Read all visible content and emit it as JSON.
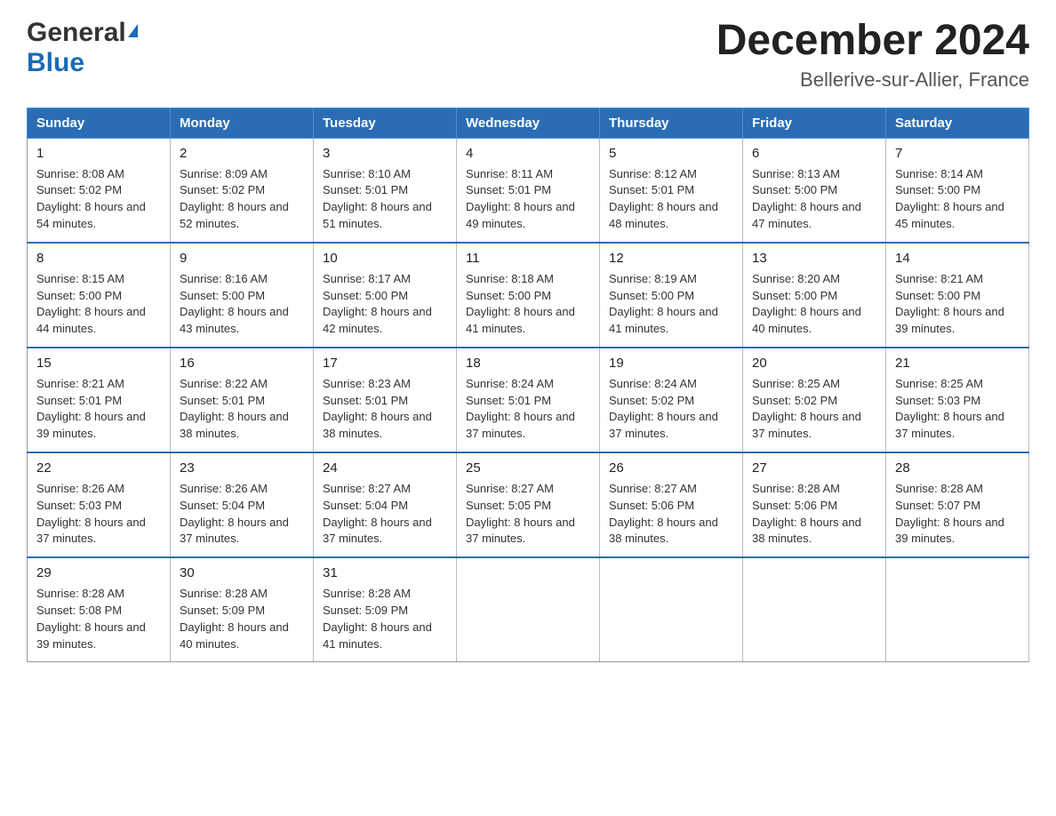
{
  "header": {
    "logo_general": "General",
    "logo_blue": "Blue",
    "month_title": "December 2024",
    "location": "Bellerive-sur-Allier, France"
  },
  "days_of_week": [
    "Sunday",
    "Monday",
    "Tuesday",
    "Wednesday",
    "Thursday",
    "Friday",
    "Saturday"
  ],
  "weeks": [
    [
      {
        "day": "1",
        "sunrise": "8:08 AM",
        "sunset": "5:02 PM",
        "daylight": "8 hours and 54 minutes."
      },
      {
        "day": "2",
        "sunrise": "8:09 AM",
        "sunset": "5:02 PM",
        "daylight": "8 hours and 52 minutes."
      },
      {
        "day": "3",
        "sunrise": "8:10 AM",
        "sunset": "5:01 PM",
        "daylight": "8 hours and 51 minutes."
      },
      {
        "day": "4",
        "sunrise": "8:11 AM",
        "sunset": "5:01 PM",
        "daylight": "8 hours and 49 minutes."
      },
      {
        "day": "5",
        "sunrise": "8:12 AM",
        "sunset": "5:01 PM",
        "daylight": "8 hours and 48 minutes."
      },
      {
        "day": "6",
        "sunrise": "8:13 AM",
        "sunset": "5:00 PM",
        "daylight": "8 hours and 47 minutes."
      },
      {
        "day": "7",
        "sunrise": "8:14 AM",
        "sunset": "5:00 PM",
        "daylight": "8 hours and 45 minutes."
      }
    ],
    [
      {
        "day": "8",
        "sunrise": "8:15 AM",
        "sunset": "5:00 PM",
        "daylight": "8 hours and 44 minutes."
      },
      {
        "day": "9",
        "sunrise": "8:16 AM",
        "sunset": "5:00 PM",
        "daylight": "8 hours and 43 minutes."
      },
      {
        "day": "10",
        "sunrise": "8:17 AM",
        "sunset": "5:00 PM",
        "daylight": "8 hours and 42 minutes."
      },
      {
        "day": "11",
        "sunrise": "8:18 AM",
        "sunset": "5:00 PM",
        "daylight": "8 hours and 41 minutes."
      },
      {
        "day": "12",
        "sunrise": "8:19 AM",
        "sunset": "5:00 PM",
        "daylight": "8 hours and 41 minutes."
      },
      {
        "day": "13",
        "sunrise": "8:20 AM",
        "sunset": "5:00 PM",
        "daylight": "8 hours and 40 minutes."
      },
      {
        "day": "14",
        "sunrise": "8:21 AM",
        "sunset": "5:00 PM",
        "daylight": "8 hours and 39 minutes."
      }
    ],
    [
      {
        "day": "15",
        "sunrise": "8:21 AM",
        "sunset": "5:01 PM",
        "daylight": "8 hours and 39 minutes."
      },
      {
        "day": "16",
        "sunrise": "8:22 AM",
        "sunset": "5:01 PM",
        "daylight": "8 hours and 38 minutes."
      },
      {
        "day": "17",
        "sunrise": "8:23 AM",
        "sunset": "5:01 PM",
        "daylight": "8 hours and 38 minutes."
      },
      {
        "day": "18",
        "sunrise": "8:24 AM",
        "sunset": "5:01 PM",
        "daylight": "8 hours and 37 minutes."
      },
      {
        "day": "19",
        "sunrise": "8:24 AM",
        "sunset": "5:02 PM",
        "daylight": "8 hours and 37 minutes."
      },
      {
        "day": "20",
        "sunrise": "8:25 AM",
        "sunset": "5:02 PM",
        "daylight": "8 hours and 37 minutes."
      },
      {
        "day": "21",
        "sunrise": "8:25 AM",
        "sunset": "5:03 PM",
        "daylight": "8 hours and 37 minutes."
      }
    ],
    [
      {
        "day": "22",
        "sunrise": "8:26 AM",
        "sunset": "5:03 PM",
        "daylight": "8 hours and 37 minutes."
      },
      {
        "day": "23",
        "sunrise": "8:26 AM",
        "sunset": "5:04 PM",
        "daylight": "8 hours and 37 minutes."
      },
      {
        "day": "24",
        "sunrise": "8:27 AM",
        "sunset": "5:04 PM",
        "daylight": "8 hours and 37 minutes."
      },
      {
        "day": "25",
        "sunrise": "8:27 AM",
        "sunset": "5:05 PM",
        "daylight": "8 hours and 37 minutes."
      },
      {
        "day": "26",
        "sunrise": "8:27 AM",
        "sunset": "5:06 PM",
        "daylight": "8 hours and 38 minutes."
      },
      {
        "day": "27",
        "sunrise": "8:28 AM",
        "sunset": "5:06 PM",
        "daylight": "8 hours and 38 minutes."
      },
      {
        "day": "28",
        "sunrise": "8:28 AM",
        "sunset": "5:07 PM",
        "daylight": "8 hours and 39 minutes."
      }
    ],
    [
      {
        "day": "29",
        "sunrise": "8:28 AM",
        "sunset": "5:08 PM",
        "daylight": "8 hours and 39 minutes."
      },
      {
        "day": "30",
        "sunrise": "8:28 AM",
        "sunset": "5:09 PM",
        "daylight": "8 hours and 40 minutes."
      },
      {
        "day": "31",
        "sunrise": "8:28 AM",
        "sunset": "5:09 PM",
        "daylight": "8 hours and 41 minutes."
      },
      null,
      null,
      null,
      null
    ]
  ]
}
